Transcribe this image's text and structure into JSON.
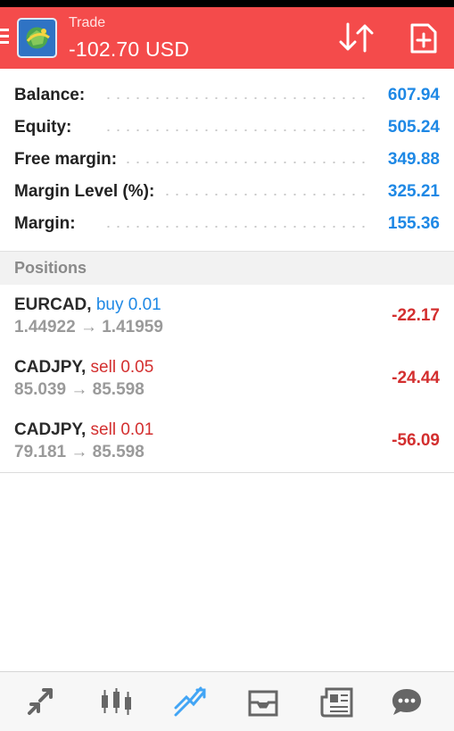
{
  "header": {
    "title": "Trade",
    "subtitle": "-102.70 USD",
    "color": "#f44b4b"
  },
  "summary": [
    {
      "label": "Balance:",
      "value": "607.94"
    },
    {
      "label": "Equity:",
      "value": "505.24"
    },
    {
      "label": "Free margin:",
      "value": "349.88"
    },
    {
      "label": "Margin Level (%):",
      "value": "325.21"
    },
    {
      "label": "Margin:",
      "value": "155.36"
    }
  ],
  "positions_header": "Positions",
  "positions": [
    {
      "symbol": "EURCAD,",
      "side": "buy 0.01",
      "prices": "1.44922 → 1.41959",
      "profit": "-22.17"
    },
    {
      "symbol": "CADJPY,",
      "side": "sell 0.05",
      "prices": "85.039 → 85.598",
      "profit": "-24.44"
    },
    {
      "symbol": "CADJPY,",
      "side": "sell 0.01",
      "prices": "79.181 → 85.598",
      "profit": "-56.09"
    }
  ],
  "bottom_nav": [
    "quotes-icon",
    "chart-icon",
    "trade-icon",
    "history-icon",
    "news-icon",
    "chat-icon"
  ],
  "colors": {
    "accent_blue": "#1e88e5",
    "loss_red": "#d32f2f"
  }
}
